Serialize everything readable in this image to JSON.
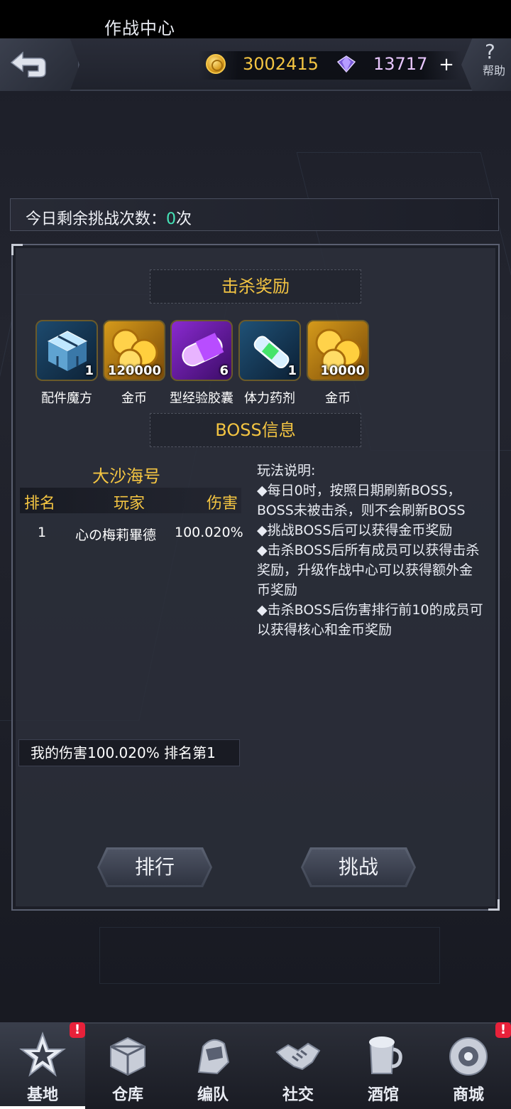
{
  "topbar": {
    "title": "作战中心",
    "coins": "3002415",
    "gems": "13717",
    "plus": "+",
    "help_symbol": "?",
    "help_label": "帮助"
  },
  "remaining": {
    "label": "今日剩余挑战次数：",
    "count": "0",
    "unit": "次"
  },
  "kill_reward": {
    "title": "击杀奖励",
    "items": [
      {
        "name": "配件魔方",
        "qty": "1",
        "icon": "cube-icon"
      },
      {
        "name": "金币",
        "qty": "120000",
        "icon": "gold-coins-icon"
      },
      {
        "name": "型经验胶囊",
        "qty": "6",
        "icon": "exp-capsule-icon"
      },
      {
        "name": "体力药剂",
        "qty": "1",
        "icon": "stamina-potion-icon"
      },
      {
        "name": "金币",
        "qty": "10000",
        "icon": "gold-coins-icon"
      }
    ]
  },
  "boss_info": {
    "title": "BOSS信息",
    "boss_name": "大沙海号",
    "columns": [
      "排名",
      "玩家",
      "伤害"
    ],
    "rows": [
      {
        "rank": "1",
        "player": "心の梅莉畢德",
        "damage": "100.020%"
      }
    ],
    "my_damage": "我的伤害100.020%   排名第1"
  },
  "rules": {
    "title": "玩法说明:",
    "lines": [
      "◆每日0时，按照日期刷新BOSS，BOSS未被击杀，则不会刷新BOSS",
      "◆挑战BOSS后可以获得金币奖励",
      "◆击杀BOSS后所有成员可以获得击杀奖励，升级作战中心可以获得额外金币奖励",
      "◆击杀BOSS后伤害排行前10的成员可以获得核心和金币奖励"
    ]
  },
  "buttons": {
    "rank": "排行",
    "challenge": "挑战"
  },
  "nav": {
    "items": [
      {
        "label": "基地",
        "icon": "base-star-icon",
        "badge": "!"
      },
      {
        "label": "仓库",
        "icon": "warehouse-icon",
        "badge": ""
      },
      {
        "label": "编队",
        "icon": "formation-icon",
        "badge": ""
      },
      {
        "label": "社交",
        "icon": "handshake-icon",
        "badge": ""
      },
      {
        "label": "酒馆",
        "icon": "tavern-icon",
        "badge": ""
      },
      {
        "label": "商城",
        "icon": "shop-icon",
        "badge": "!"
      }
    ]
  },
  "colors": {
    "accent_gold": "#f4c542",
    "count_green": "#46e4b8",
    "badge_red": "#e8213a"
  }
}
